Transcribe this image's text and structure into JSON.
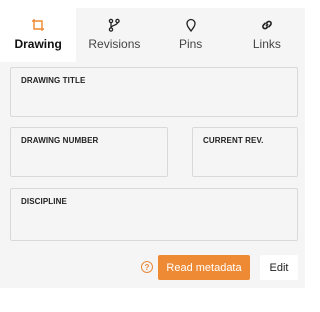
{
  "tabs": [
    {
      "label": "Drawing",
      "icon": "crop-frame-icon",
      "active": true
    },
    {
      "label": "Revisions",
      "icon": "branch-icon",
      "active": false
    },
    {
      "label": "Pins",
      "icon": "map-pin-icon",
      "active": false
    },
    {
      "label": "Links",
      "icon": "link-icon",
      "active": false
    }
  ],
  "fields": {
    "drawing_title": {
      "label": "DRAWING TITLE",
      "value": ""
    },
    "drawing_number": {
      "label": "DRAWING NUMBER",
      "value": ""
    },
    "current_rev": {
      "label": "CURRENT REV.",
      "value": ""
    },
    "discipline": {
      "label": "DISCIPLINE",
      "value": ""
    }
  },
  "actions": {
    "help_icon": "question-circle-icon",
    "read_metadata_label": "Read metadata",
    "edit_label": "Edit"
  },
  "colors": {
    "accent": "#ef8a34",
    "panel_bg": "#f5f5f5",
    "active_tab_bg": "#ffffff"
  }
}
